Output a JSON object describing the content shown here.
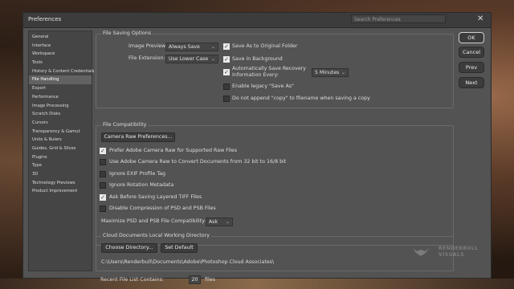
{
  "window": {
    "title": "Preferences",
    "search_placeholder": "Search Preferences"
  },
  "sidebar": {
    "items": [
      {
        "label": "General"
      },
      {
        "label": "Interface"
      },
      {
        "label": "Workspace"
      },
      {
        "label": "Tools"
      },
      {
        "label": "History & Content Credentials"
      },
      {
        "label": "File Handling",
        "active": true
      },
      {
        "label": "Export"
      },
      {
        "label": "Performance"
      },
      {
        "label": "Image Processing"
      },
      {
        "label": "Scratch Disks"
      },
      {
        "label": "Cursors"
      },
      {
        "label": "Transparency & Gamut"
      },
      {
        "label": "Units & Rulers"
      },
      {
        "label": "Guides, Grid & Slices"
      },
      {
        "label": "Plugins"
      },
      {
        "label": "Type"
      },
      {
        "label": "3D"
      },
      {
        "label": "Technology Previews"
      },
      {
        "label": "Product Improvement"
      }
    ]
  },
  "file_saving": {
    "title": "File Saving Options",
    "image_previews_label": "Image Previews:",
    "image_previews_value": "Always Save",
    "file_extension_label": "File Extension:",
    "file_extension_value": "Use Lower Case",
    "save_as_original": {
      "label": "Save As to Original Folder",
      "checked": true
    },
    "save_in_background": {
      "label": "Save in Background",
      "checked": true
    },
    "auto_save": {
      "label_line1": "Automatically Save Recovery",
      "label_line2": "Information Every:",
      "checked": true
    },
    "auto_save_interval": "5 Minutes",
    "legacy_save_as": {
      "label": "Enable legacy \"Save As\"",
      "checked": false
    },
    "no_copy": {
      "label": "Do not append \"copy\" to filename when saving a copy",
      "checked": false
    }
  },
  "file_compat": {
    "title": "File Compatibility",
    "camera_raw_prefs_button": "Camera Raw Preferences...",
    "options": [
      {
        "label": "Prefer Adobe Camera Raw for Supported Raw Files",
        "checked": true
      },
      {
        "label": "Use Adobe Camera Raw to Convert Documents from 32 bit to 16/8 bit",
        "checked": false
      },
      {
        "label": "Ignore EXIF Profile Tag",
        "checked": false
      },
      {
        "label": "Ignore Rotation Metadata",
        "checked": false
      },
      {
        "label": "Ask Before Saving Layered TIFF Files",
        "checked": true
      },
      {
        "label": "Disable Compression of PSD and PSB Files",
        "checked": false
      }
    ],
    "maximize_label": "Maximize PSD and PSB File Compatibility:",
    "maximize_value": "Ask"
  },
  "cloud": {
    "title": "Cloud Documents Local Working Directory",
    "choose_button": "Choose Directory...",
    "default_button": "Set Default",
    "path": "C:\\Users\\Renderbull\\Documents\\Adobe\\Photoshop Cloud Associates\\"
  },
  "recent": {
    "label": "Recent File List Contains:",
    "value": "20",
    "suffix": "files"
  },
  "buttons": {
    "ok": "OK",
    "cancel": "Cancel",
    "prev": "Prev",
    "next": "Next"
  },
  "watermark": {
    "line1": "RENDERBULL",
    "line2": "VISUALS"
  },
  "colors": {
    "dialog_bg": "#535353",
    "titlebar": "#3c3c3c",
    "sidebar_active": "#626262"
  }
}
